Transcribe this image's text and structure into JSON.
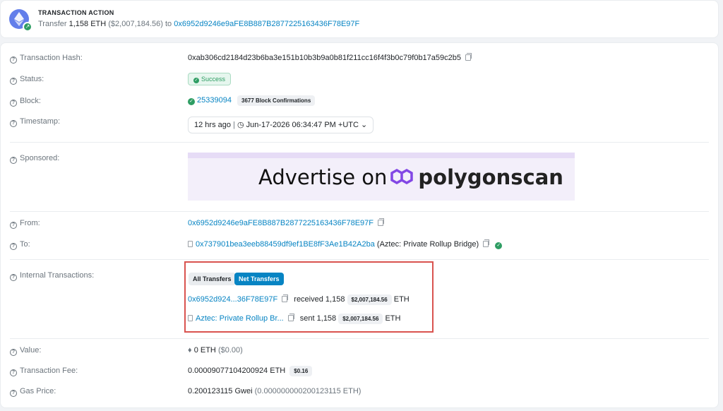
{
  "action": {
    "title": "TRANSACTION ACTION",
    "prefix": "Transfer",
    "amount": "1,158",
    "asset": "ETH",
    "usd": "($2,007,184.56)",
    "to_word": "to",
    "to_address": "0x6952d9246e9aFE8B887B2877225163436F78E97F"
  },
  "details": {
    "hash": {
      "label": "Transaction Hash:",
      "value": "0xab306cd2184d23b6ba3e151b10b3b9a0b81f211cc16f4f3b0c79f0b17a59c2b5"
    },
    "status": {
      "label": "Status:",
      "value": "Success"
    },
    "block": {
      "label": "Block:",
      "number": "25339094",
      "confirmations": "3677 Block Confirmations"
    },
    "timestamp": {
      "label": "Timestamp:",
      "ago": "12 hrs ago",
      "separator": "|",
      "date": "Jun-17-2026 06:34:47 PM +UTC"
    },
    "sponsored": {
      "label": "Sponsored:",
      "ad_text": "Advertise on",
      "ad_brand": "polygonscan"
    },
    "from": {
      "label": "From:",
      "address": "0x6952d9246e9aFE8B887B2877225163436F78E97F"
    },
    "to": {
      "label": "To:",
      "address": "0x737901bea3eeb88459df9ef1BE8fF3Ae1B42A2ba",
      "name": "(Aztec: Private Rollup Bridge)"
    },
    "internal": {
      "label": "Internal Transactions:",
      "tabs": [
        "All Transfers",
        "Net Transfers"
      ],
      "rows": [
        {
          "party": "0x6952d924...36F78E97F",
          "action": "received",
          "amount": "1,158",
          "usd": "$2,007,184.56",
          "asset": "ETH"
        },
        {
          "party": "Aztec: Private Rollup Br...",
          "action": "sent",
          "amount": "1,158",
          "usd": "$2,007,184.56",
          "asset": "ETH"
        }
      ]
    },
    "value": {
      "label": "Value:",
      "amount": "0 ETH",
      "usd": "($0.00)"
    },
    "fee": {
      "label": "Transaction Fee:",
      "amount": "0.00009077104200924 ETH",
      "usd": "$0.16"
    },
    "gas": {
      "label": "Gas Price:",
      "amount": "0.200123115 Gwei",
      "eth": "(0.000000000200123115 ETH)"
    }
  },
  "colors": {
    "link": "#0784c3",
    "success": "#2e9d63",
    "highlight_border": "#d9534f",
    "polygon": "#8247e5"
  },
  "icons": [
    "ethereum-icon",
    "arrow-up-right-icon",
    "question-icon",
    "copy-icon",
    "check-circle-icon",
    "clock-icon",
    "chevron-down-icon",
    "contract-icon",
    "verified-icon",
    "eth-diamond-icon",
    "polygon-logo"
  ]
}
